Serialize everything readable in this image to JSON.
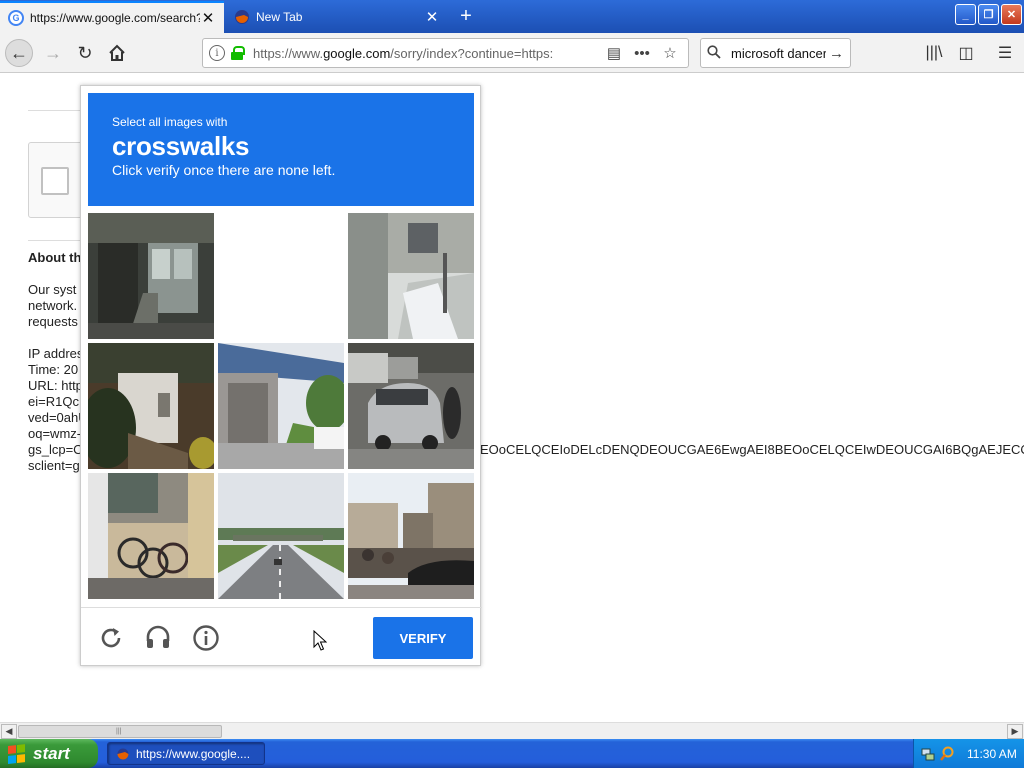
{
  "browser": {
    "tabs": [
      {
        "title": "https://www.google.com/search?q",
        "icon": "google-icon",
        "active": true
      },
      {
        "title": "New Tab",
        "icon": "firefox-icon",
        "active": false
      }
    ],
    "url": {
      "prefix": "https://www.",
      "domain": "google.com",
      "path": "/sorry/index?continue=https:"
    },
    "search_value": "microsoft dancer"
  },
  "page": {
    "about_heading": "About th",
    "para1": [
      "Our syst",
      "network.",
      "requests"
    ],
    "para2": [
      "IP addres",
      "Time: 20",
      "URL: http",
      "ei=R1Qc",
      "ved=0ahU",
      "oq=wmz-",
      "gs_lcp=C",
      "sclient=g"
    ],
    "long_line": "EOoCELQCEIoDELcDENQDEOUCGAE6EwgAEI8BEOoCELQCEIwDEOUCGAI6BQgAEJECOg"
  },
  "captcha": {
    "header_small": "Select all images with",
    "header_keyword": "crosswalks",
    "header_instruction": "Click verify once there are none left.",
    "verify_label": "VERIFY",
    "tiles": [
      "store-entrance",
      "blank-loading",
      "residential-street",
      "small-building",
      "highway-overpass",
      "car-and-motorcycle",
      "parked-bicycles",
      "highway",
      "market-street"
    ],
    "accent": "#1a73e8"
  },
  "taskbar": {
    "start_label": "start",
    "item_label": "https://www.google....",
    "clock": "11:30 AM"
  }
}
